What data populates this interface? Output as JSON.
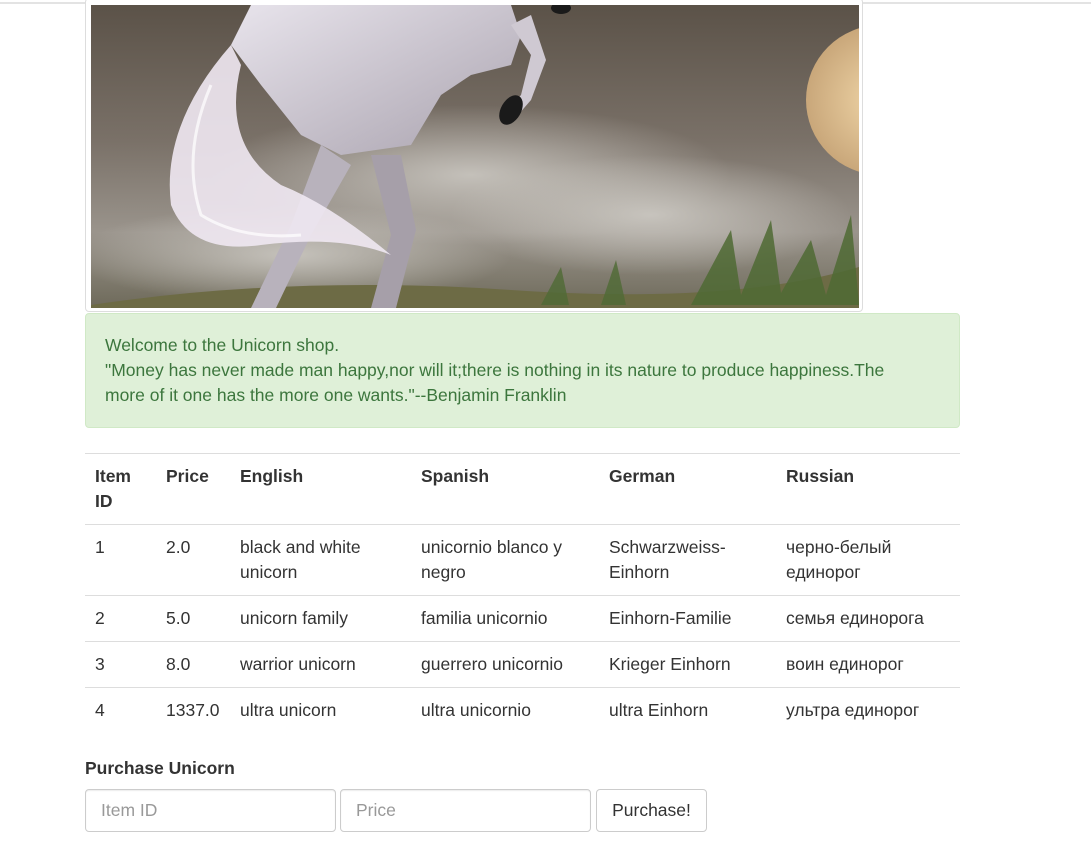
{
  "hero_image": {
    "description_icon": "unicorn-image"
  },
  "alert": {
    "welcome": "Welcome to the Unicorn shop.",
    "quote": "\"Money has never made man happy,nor will it;there is nothing in its nature to produce happiness.The more of it one has the more one wants.\"--Benjamin Franklin"
  },
  "table": {
    "headers": [
      "Item ID",
      "Price",
      "English",
      "Spanish",
      "German",
      "Russian"
    ],
    "rows": [
      [
        "1",
        "2.0",
        "black and white unicorn",
        "unicornio blanco y negro",
        "Schwarzweiss-Einhorn",
        "черно-белый единорог"
      ],
      [
        "2",
        "5.0",
        "unicorn family",
        "familia unicornio",
        "Einhorn-Familie",
        "семья единорога"
      ],
      [
        "3",
        "8.0",
        "warrior unicorn",
        "guerrero unicornio",
        "Krieger Einhorn",
        "воин единорог"
      ],
      [
        "4",
        "1337.0",
        "ultra unicorn",
        "ultra unicornio",
        "ultra Einhorn",
        "ультра единорог"
      ]
    ]
  },
  "purchase": {
    "title": "Purchase Unicorn",
    "item_id_placeholder": "Item ID",
    "price_placeholder": "Price",
    "button_label": "Purchase!"
  },
  "colors": {
    "alert_bg": "#dff0d8",
    "alert_text": "#3c763d",
    "border": "#dddddd"
  }
}
